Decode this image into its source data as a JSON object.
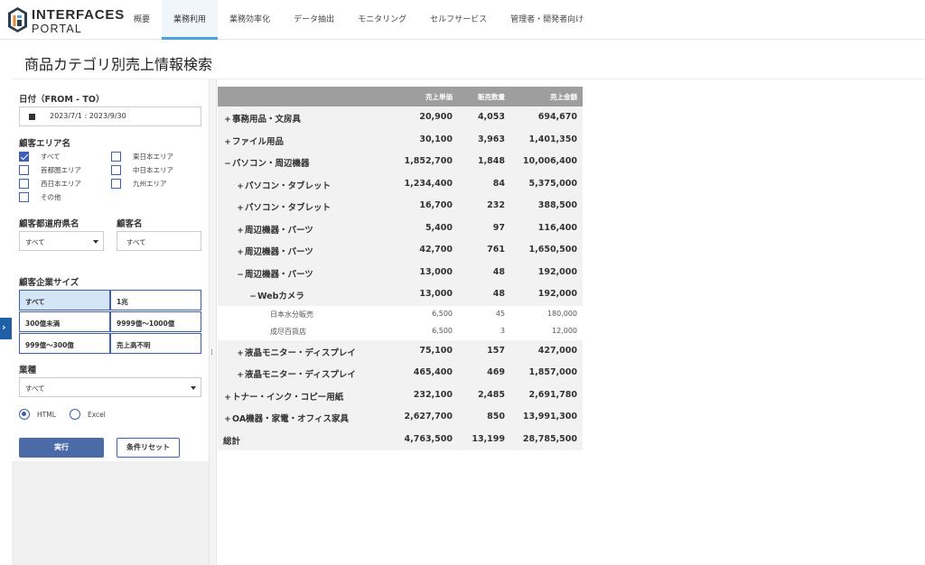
{
  "header": {
    "logo_line1": "INTERFACES",
    "logo_line2": "PORTAL",
    "nav": [
      "概要",
      "業務利用",
      "業務効率化",
      "データ抽出",
      "モニタリング",
      "セルフサービス",
      "管理者・開発者向け"
    ],
    "active_nav": "業務利用"
  },
  "page_title": "商品カテゴリ別売上情報検索",
  "sidebar": {
    "date_label": "日付（FROM - TO）",
    "date_value": "2023/7/1 : 2023/9/30",
    "area_label": "顧客エリア名",
    "areas": [
      {
        "label": "すべて",
        "checked": true
      },
      {
        "label": "東日本エリア",
        "checked": false
      },
      {
        "label": "首都圏エリア",
        "checked": false
      },
      {
        "label": "中日本エリア",
        "checked": false
      },
      {
        "label": "西日本エリア",
        "checked": false
      },
      {
        "label": "九州エリア",
        "checked": false
      },
      {
        "label": "その他",
        "checked": false
      }
    ],
    "pref_label": "顧客都道府県名",
    "pref_value": "すべて",
    "customer_label": "顧客名",
    "customer_value": "すべて",
    "size_label": "顧客企業サイズ",
    "sizes": [
      "すべて",
      "1兆",
      "300億未満",
      "9999億～1000億",
      "999億～300億",
      "売上高不明"
    ],
    "selected_size": "すべて",
    "industry_label": "業種",
    "industry_value": "すべて",
    "formats": [
      "HTML",
      "Excel"
    ],
    "selected_format": "HTML",
    "run_label": "実行",
    "reset_label": "条件リセット"
  },
  "table": {
    "headers": [
      "売上単価",
      "販売数量",
      "売上金額"
    ],
    "rows": [
      {
        "label": "事務用品・文房具",
        "level": 0,
        "toggle": "+",
        "v1": "20,900",
        "v2": "4,053",
        "v3": "694,670"
      },
      {
        "label": "ファイル用品",
        "level": 0,
        "toggle": "+",
        "v1": "30,100",
        "v2": "3,963",
        "v3": "1,401,350"
      },
      {
        "label": "パソコン・周辺機器",
        "level": 0,
        "toggle": "−",
        "v1": "1,852,700",
        "v2": "1,848",
        "v3": "10,006,400"
      },
      {
        "label": "パソコン・タブレット",
        "level": 1,
        "toggle": "+",
        "v1": "1,234,400",
        "v2": "84",
        "v3": "5,375,000"
      },
      {
        "label": "パソコン・タブレット",
        "level": 1,
        "toggle": "+",
        "v1": "16,700",
        "v2": "232",
        "v3": "388,500"
      },
      {
        "label": "周辺機器・パーツ",
        "level": 1,
        "toggle": "+",
        "v1": "5,400",
        "v2": "97",
        "v3": "116,400"
      },
      {
        "label": "周辺機器・パーツ",
        "level": 1,
        "toggle": "+",
        "v1": "42,700",
        "v2": "761",
        "v3": "1,650,500"
      },
      {
        "label": "周辺機器・パーツ",
        "level": 1,
        "toggle": "−",
        "v1": "13,000",
        "v2": "48",
        "v3": "192,000"
      },
      {
        "label": "Webカメラ",
        "level": 2,
        "toggle": "−",
        "v1": "13,000",
        "v2": "48",
        "v3": "192,000"
      },
      {
        "label": "日本水分販売",
        "level": 3,
        "toggle": "",
        "v1": "6,500",
        "v2": "45",
        "v3": "180,000"
      },
      {
        "label": "成尽百貨店",
        "level": 3,
        "toggle": "",
        "v1": "6,500",
        "v2": "3",
        "v3": "12,000"
      },
      {
        "label": "液晶モニター・ディスプレイ",
        "level": 1,
        "toggle": "+",
        "v1": "75,100",
        "v2": "157",
        "v3": "427,000"
      },
      {
        "label": "液晶モニター・ディスプレイ",
        "level": 1,
        "toggle": "+",
        "v1": "465,400",
        "v2": "469",
        "v3": "1,857,000"
      },
      {
        "label": "トナー・インク・コピー用紙",
        "level": 0,
        "toggle": "+",
        "v1": "232,100",
        "v2": "2,485",
        "v3": "2,691,780"
      },
      {
        "label": "OA機器・家電・オフィス家具",
        "level": 0,
        "toggle": "+",
        "v1": "2,627,700",
        "v2": "850",
        "v3": "13,991,300"
      }
    ],
    "total": {
      "label": "総計",
      "v1": "4,763,500",
      "v2": "13,199",
      "v3": "28,785,500"
    }
  },
  "colors": {
    "accent": "#3f5fb5",
    "button": "#4a6aa8",
    "header_gray": "#9e9e9e",
    "nav_active": "#4aa3df"
  }
}
